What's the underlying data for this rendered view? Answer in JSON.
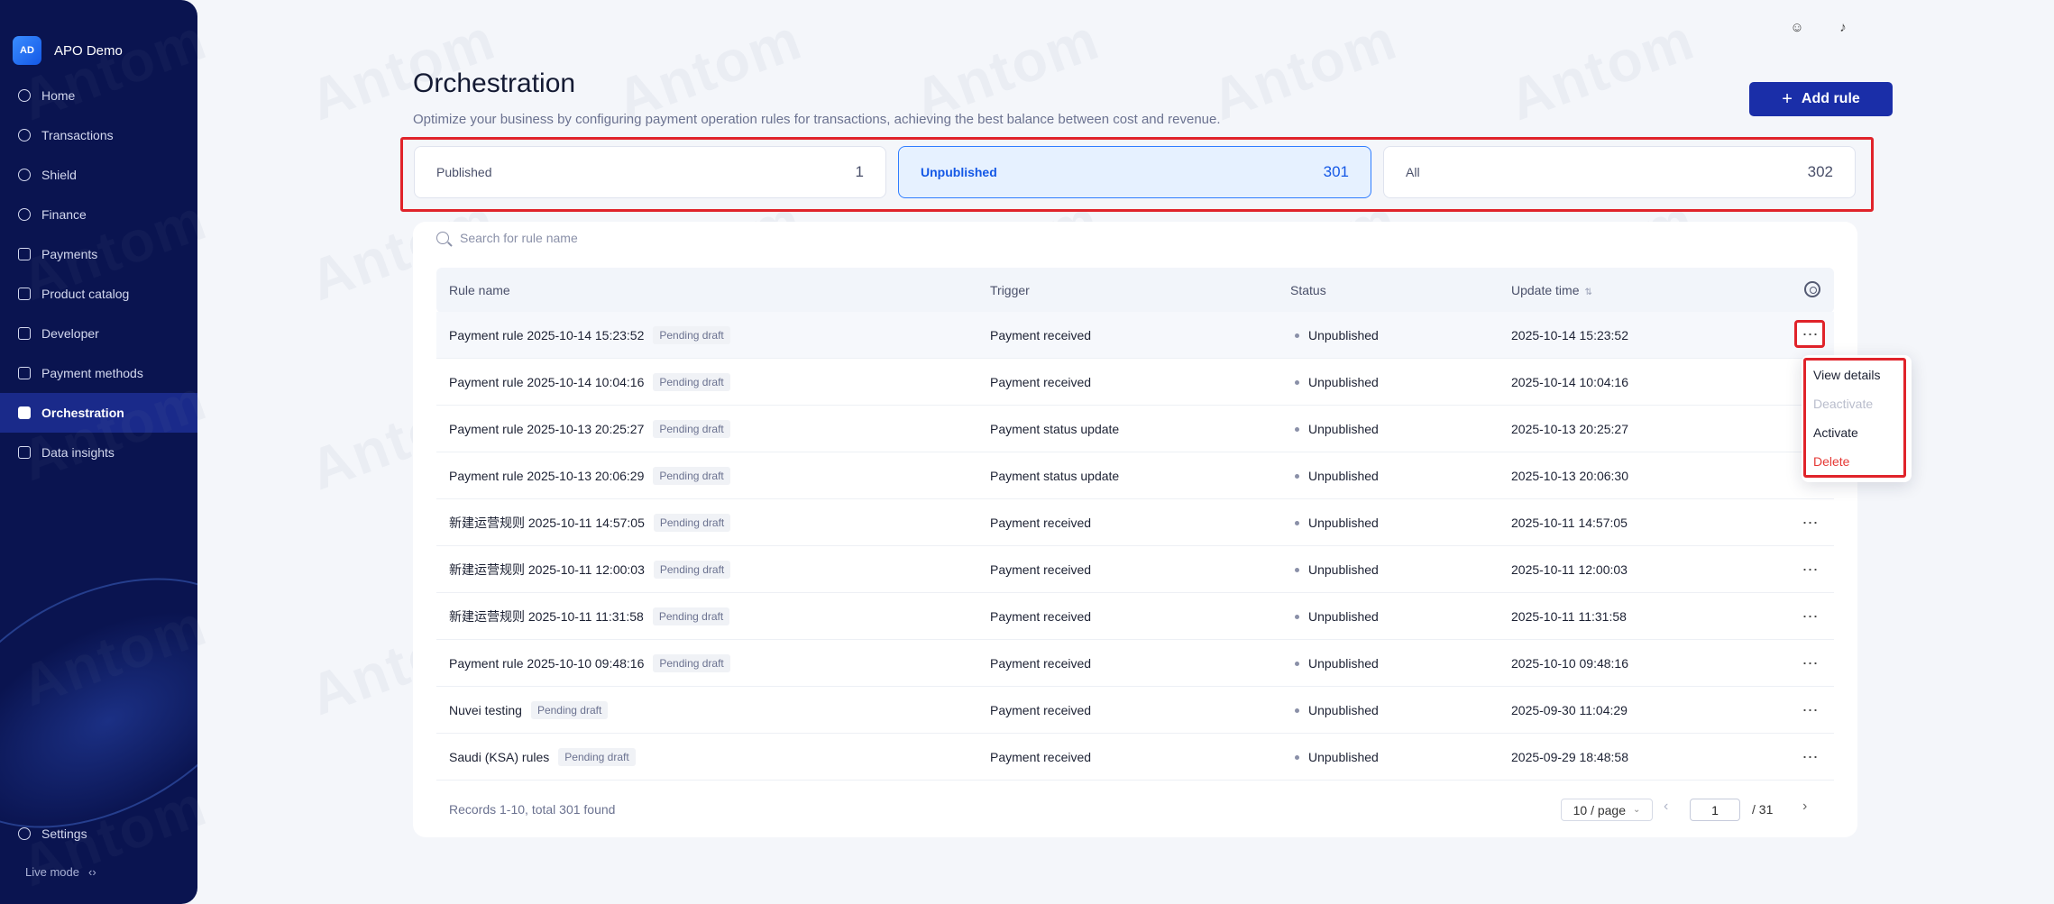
{
  "app": {
    "logo_text": "AD",
    "name": "APO Demo"
  },
  "sidebar": {
    "items": [
      {
        "label": "Home",
        "icon": "home-icon"
      },
      {
        "label": "Transactions",
        "icon": "transactions-icon"
      },
      {
        "label": "Shield",
        "icon": "shield-icon"
      },
      {
        "label": "Finance",
        "icon": "finance-icon"
      },
      {
        "label": "Payments",
        "icon": "payments-icon"
      },
      {
        "label": "Product catalog",
        "icon": "catalog-icon"
      },
      {
        "label": "Developer",
        "icon": "developer-icon"
      },
      {
        "label": "Payment methods",
        "icon": "wallet-icon"
      },
      {
        "label": "Orchestration",
        "icon": "orchestration-icon"
      },
      {
        "label": "Data insights",
        "icon": "chart-icon"
      }
    ],
    "settings": "Settings",
    "live_mode": "Live mode",
    "live_mode_icon": "switch-icon"
  },
  "header": {
    "title": "Orchestration",
    "subtitle": "Optimize your business by configuring payment operation rules for transactions, achieving the best balance between cost and revenue.",
    "add_rule": "Add rule"
  },
  "tabs": [
    {
      "label": "Published",
      "count": "1"
    },
    {
      "label": "Unpublished",
      "count": "301"
    },
    {
      "label": "All",
      "count": "302"
    }
  ],
  "search": {
    "placeholder": "Search for rule name"
  },
  "table": {
    "columns": {
      "rule_name": "Rule name",
      "trigger": "Trigger",
      "status": "Status",
      "update_time": "Update time"
    },
    "rows": [
      {
        "name": "Payment rule 2025-10-14 15:23:52",
        "badge": "Pending draft",
        "trigger": "Payment received",
        "status": "Unpublished",
        "time": "2025-10-14 15:23:52"
      },
      {
        "name": "Payment rule 2025-10-14 10:04:16",
        "badge": "Pending draft",
        "trigger": "Payment received",
        "status": "Unpublished",
        "time": "2025-10-14 10:04:16"
      },
      {
        "name": "Payment rule 2025-10-13 20:25:27",
        "badge": "Pending draft",
        "trigger": "Payment status update",
        "status": "Unpublished",
        "time": "2025-10-13 20:25:27"
      },
      {
        "name": "Payment rule 2025-10-13 20:06:29",
        "badge": "Pending draft",
        "trigger": "Payment status update",
        "status": "Unpublished",
        "time": "2025-10-13 20:06:30"
      },
      {
        "name": "新建运营规则 2025-10-11 14:57:05",
        "badge": "Pending draft",
        "trigger": "Payment received",
        "status": "Unpublished",
        "time": "2025-10-11 14:57:05"
      },
      {
        "name": "新建运营规则 2025-10-11 12:00:03",
        "badge": "Pending draft",
        "trigger": "Payment received",
        "status": "Unpublished",
        "time": "2025-10-11 12:00:03"
      },
      {
        "name": "新建运营规则 2025-10-11 11:31:58",
        "badge": "Pending draft",
        "trigger": "Payment received",
        "status": "Unpublished",
        "time": "2025-10-11 11:31:58"
      },
      {
        "name": "Payment rule 2025-10-10 09:48:16",
        "badge": "Pending draft",
        "trigger": "Payment received",
        "status": "Unpublished",
        "time": "2025-10-10 09:48:16"
      },
      {
        "name": "Nuvei testing",
        "badge": "Pending draft",
        "trigger": "Payment received",
        "status": "Unpublished",
        "time": "2025-09-30 11:04:29"
      },
      {
        "name": "Saudi (KSA) rules",
        "badge": "Pending draft",
        "trigger": "Payment received",
        "status": "Unpublished",
        "time": "2025-09-29 18:48:58"
      }
    ]
  },
  "dropdown": {
    "view_details": "View details",
    "deactivate": "Deactivate",
    "activate": "Activate",
    "delete": "Delete"
  },
  "footer": {
    "records": "Records 1-10, total 301 found",
    "page_size": "10 / page",
    "current_page": "1",
    "total_pages": "/   31"
  },
  "watermark": "Antom",
  "colors": {
    "brand": "#1a2ea8",
    "sidebar": "#0a1450",
    "highlight": "#e0232a",
    "danger": "#e53935"
  }
}
